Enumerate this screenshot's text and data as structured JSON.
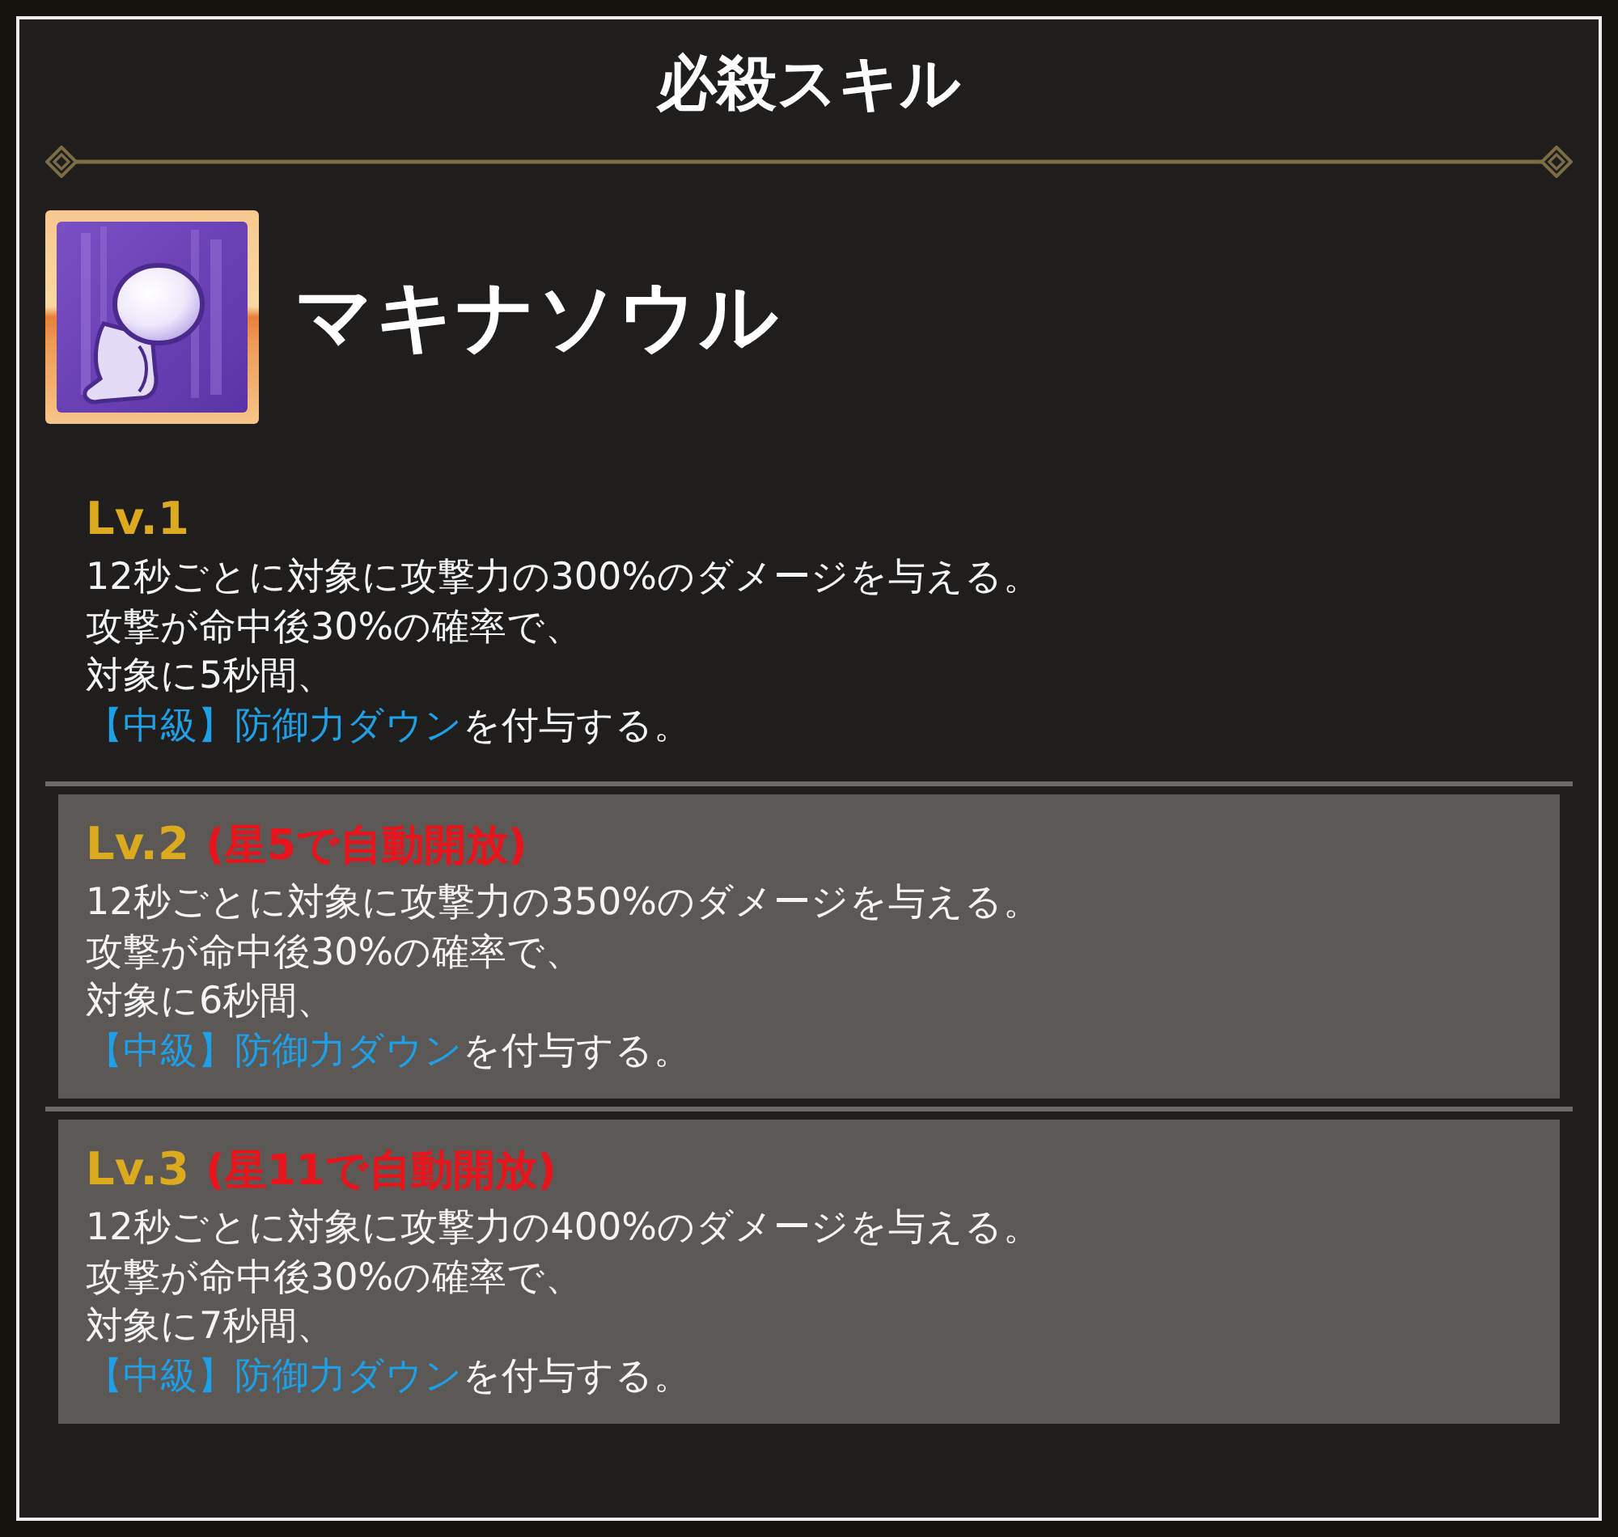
{
  "title": "必殺スキル",
  "skill": {
    "name": "マキナソウル"
  },
  "levels": [
    {
      "label": "Lv.1",
      "locked": false,
      "lines": [
        [
          {
            "kind": "plain",
            "text": "12秒ごとに対象に攻撃力の300%のダメージを与える。"
          }
        ],
        [
          {
            "kind": "plain",
            "text": "攻撃が命中後30%の確率で、"
          }
        ],
        [
          {
            "kind": "plain",
            "text": "対象に5秒間、"
          }
        ],
        [
          {
            "kind": "term",
            "text": "【中級】防御力ダウン"
          },
          {
            "kind": "plain",
            "text": "を付与する。"
          }
        ]
      ]
    },
    {
      "label": "Lv.2",
      "unlock_note": "(星5で自動開放)",
      "locked": true,
      "lines": [
        [
          {
            "kind": "plain",
            "text": "12秒ごとに対象に攻撃力の350%のダメージを与える。"
          }
        ],
        [
          {
            "kind": "plain",
            "text": "攻撃が命中後30%の確率で、"
          }
        ],
        [
          {
            "kind": "plain",
            "text": "対象に6秒間、"
          }
        ],
        [
          {
            "kind": "term",
            "text": "【中級】防御力ダウン"
          },
          {
            "kind": "plain",
            "text": "を付与する。"
          }
        ]
      ]
    },
    {
      "label": "Lv.3",
      "unlock_note": "(星11で自動開放)",
      "locked": true,
      "lines": [
        [
          {
            "kind": "plain",
            "text": "12秒ごとに対象に攻撃力の400%のダメージを与える。"
          }
        ],
        [
          {
            "kind": "plain",
            "text": "攻撃が命中後30%の確率で、"
          }
        ],
        [
          {
            "kind": "plain",
            "text": "対象に7秒間、"
          }
        ],
        [
          {
            "kind": "term",
            "text": "【中級】防御力ダウン"
          },
          {
            "kind": "plain",
            "text": "を付与する。"
          }
        ]
      ]
    }
  ]
}
